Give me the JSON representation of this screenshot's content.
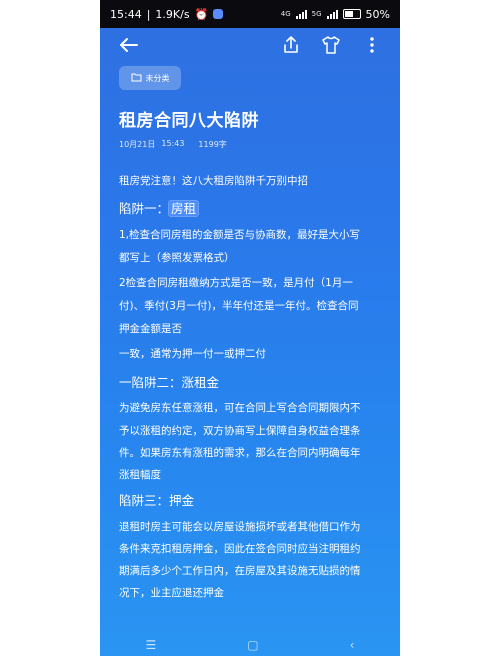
{
  "status_bar": {
    "time": "15:44",
    "speed": "1.9K/s",
    "alarm_icon": "alarm-icon",
    "network1": "4G",
    "network2": "5G",
    "battery": "50%"
  },
  "header": {
    "back_icon": "back-arrow-icon",
    "share_icon": "share-icon",
    "theme_icon": "tshirt-icon",
    "more_icon": "more-vertical-icon"
  },
  "note": {
    "folder_label": "未分类",
    "title": "租房合同八大陷阱",
    "date": "10月21日",
    "time": "15:43",
    "char_count": "1199字",
    "intro": "租房党注意！这八大租房陷阱千万别中招",
    "h1_prefix": "陷阱一：",
    "h1_highlight": "房租",
    "p1a": "1,检查合同房租的金额是否与协商数，最好是大小写",
    "p1b": "都写上（参照发票格式）",
    "p2a": "2检查合同房租缴纳方式是否一致，是月付（1月一",
    "p2b": "付)、季付(3月一付)，半年付还是一年付。检查合同",
    "p2c": "押金金额是否",
    "p3": "一致，通常为押一付一或押二付",
    "h2": "一陷阱二：涨租金",
    "p4a": "为避免房东任意涨租，可在合同上写合合同期限内不",
    "p4b": "予以涨租的约定，双方协商写上保障自身权益合理条",
    "p4c": "件。如果房东有涨租的需求，那么在合同内明确每年",
    "p4d": "涨租幅度",
    "h3": "陷阱三：押金",
    "p5a": "退租时房主可能会以房屋设施损坏或者其他借口作为",
    "p5b": "条件来克扣租房押金，因此在签合同时应当注明租约",
    "p5c": "期满后多少个工作日内，在房屋及其设施无贴损的情",
    "p5d": "况下，业主应退还押金"
  },
  "navbar": {
    "menu": "☰",
    "home": "▢",
    "back": "‹"
  },
  "colors": {
    "background_top": "#2f6fe0",
    "background_bottom": "#2a95f2",
    "highlight": "#4d8eff"
  }
}
